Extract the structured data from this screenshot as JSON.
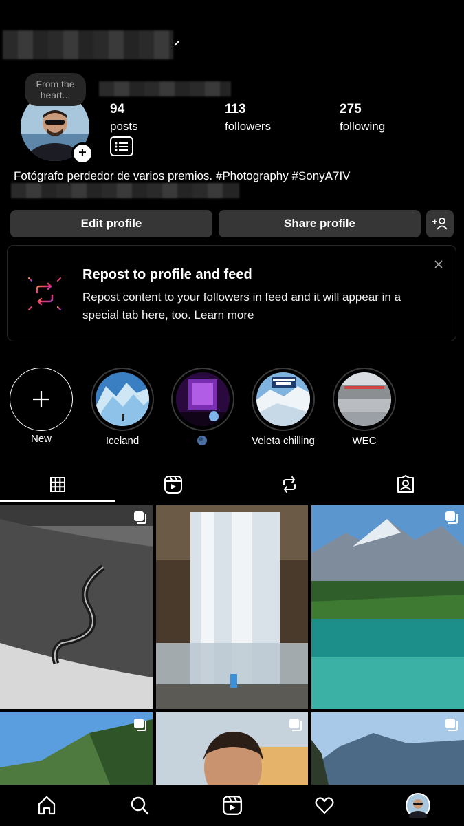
{
  "profile": {
    "note": "From the heart...",
    "stats": [
      {
        "value": "94",
        "label": "posts"
      },
      {
        "value": "113",
        "label": "followers"
      },
      {
        "value": "275",
        "label": "following"
      }
    ],
    "bio": "Fotógrafo perdedor de varios premios. #Photography #SonyA7IV"
  },
  "buttons": {
    "edit": "Edit profile",
    "share": "Share profile"
  },
  "repost_card": {
    "title": "Repost to profile and feed",
    "text": "Repost content to your followers in feed and it will appear in a special tab here, too. Learn more"
  },
  "highlights": [
    {
      "label": "New"
    },
    {
      "label": "Iceland"
    },
    {
      "label": ""
    },
    {
      "label": "Veleta chilling"
    },
    {
      "label": "WEC"
    }
  ],
  "tabs": [
    "grid-icon",
    "reels-icon",
    "reposts-icon",
    "tagged-icon"
  ],
  "nav": [
    "home-icon",
    "search-icon",
    "reels-icon",
    "heart-icon",
    "profile-avatar"
  ],
  "colors": {
    "background": "#000000",
    "button": "#363636",
    "card_border": "#262626"
  }
}
